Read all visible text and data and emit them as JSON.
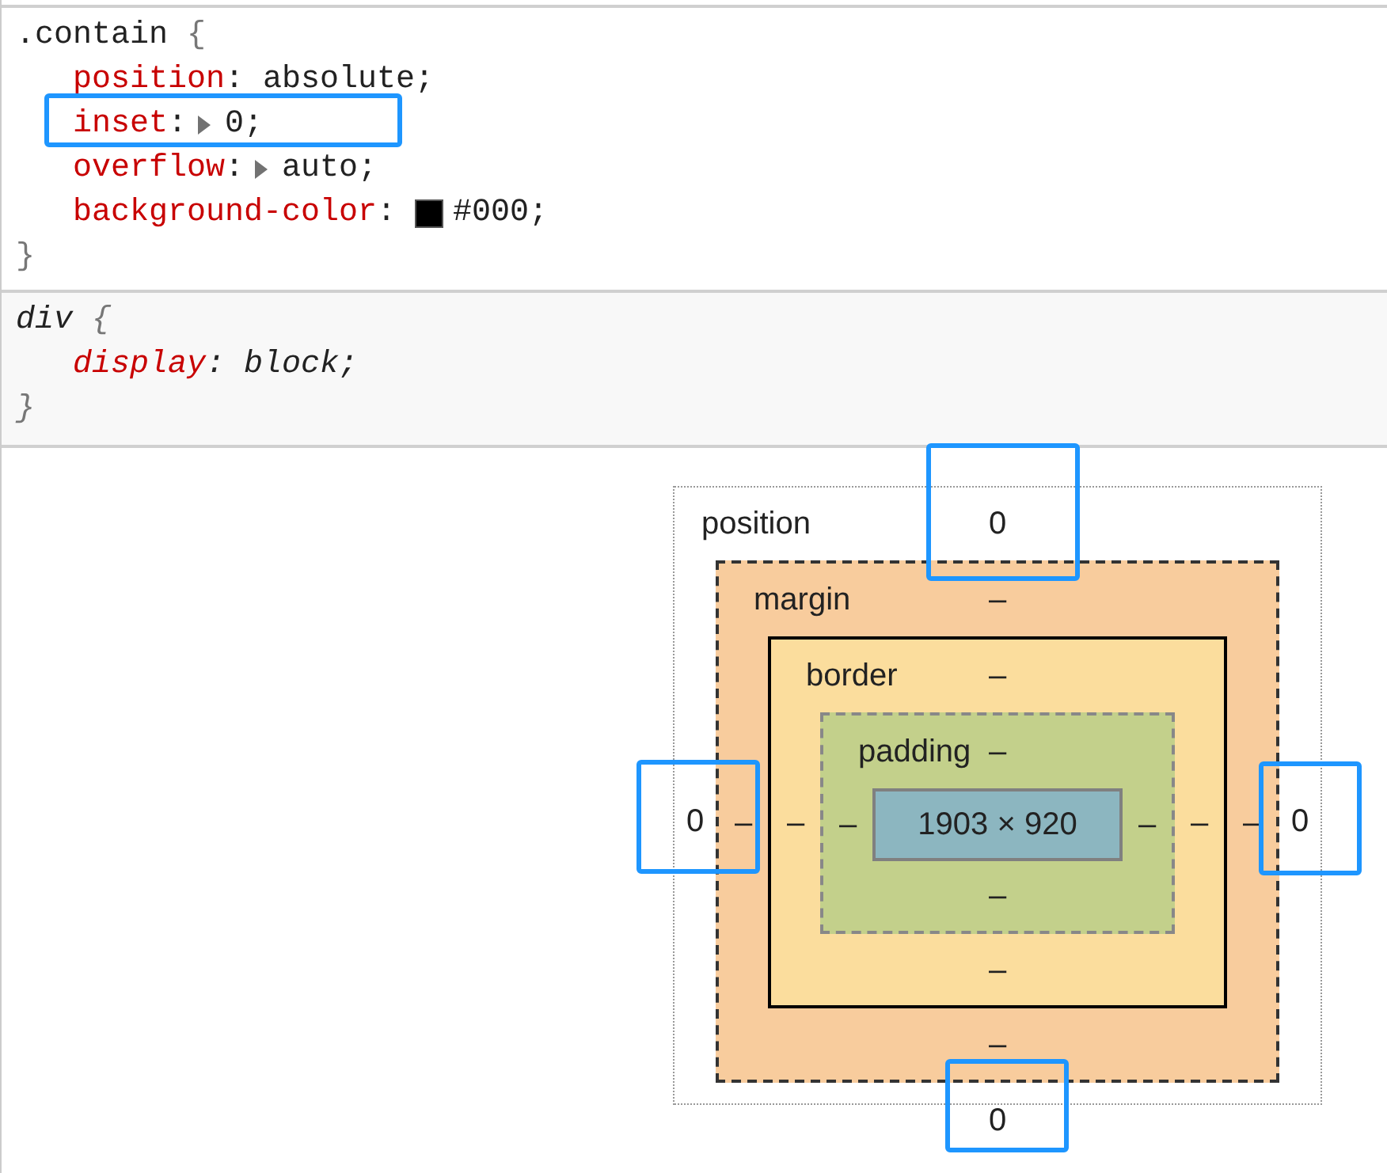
{
  "rules": [
    {
      "selector": ".contain",
      "open": "{",
      "close": "}",
      "user_agent": false,
      "declarations": [
        {
          "property": "position",
          "colon": ":",
          "value": "absolute;",
          "expandable": false,
          "highlighted": false
        },
        {
          "property": "inset",
          "colon": ":",
          "value": "0;",
          "expandable": true,
          "highlighted": true
        },
        {
          "property": "overflow",
          "colon": ":",
          "value": "auto;",
          "expandable": true,
          "highlighted": false
        },
        {
          "property": "background-color",
          "colon": ":",
          "value": "#000;",
          "expandable": false,
          "highlighted": false,
          "color": "#000000"
        }
      ]
    },
    {
      "selector": "div",
      "open": "{",
      "close": "}",
      "user_agent": true,
      "declarations": [
        {
          "property": "display",
          "colon": ":",
          "value": "block;",
          "expandable": false,
          "highlighted": false
        }
      ]
    }
  ],
  "box_model": {
    "position": {
      "label": "position",
      "top": {
        "value": "0",
        "highlighted": true
      },
      "left": {
        "value": "0",
        "highlighted": true
      },
      "right": {
        "value": "0",
        "highlighted": true
      },
      "bottom": {
        "value": "0",
        "highlighted": true
      }
    },
    "margin": {
      "label": "margin",
      "top": "–",
      "left": "–",
      "right": "–",
      "bottom": "–"
    },
    "border": {
      "label": "border",
      "top": "–",
      "left": "–",
      "right": "–",
      "bottom": "–"
    },
    "padding": {
      "label": "padding",
      "top": "–",
      "left": "–",
      "right": "–",
      "bottom": "–"
    },
    "content": "1903 × 920"
  }
}
